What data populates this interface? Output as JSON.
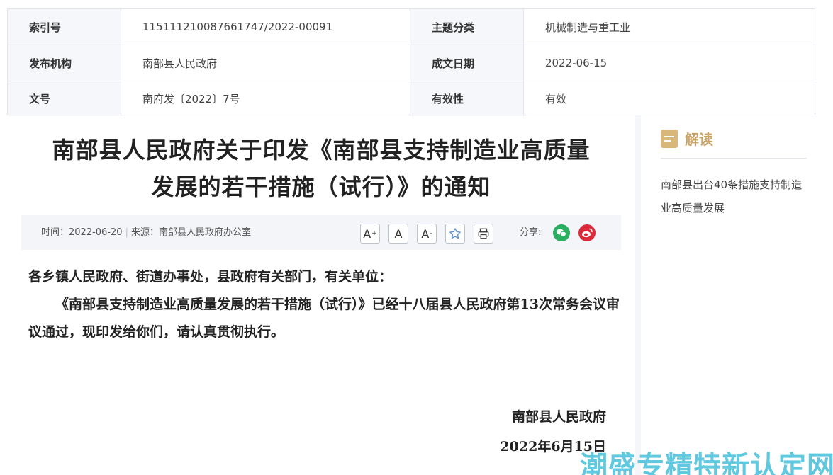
{
  "meta": {
    "rows": [
      {
        "label1": "索引号",
        "value1": "115111210087661747/2022-00091",
        "label2": "主题分类",
        "value2": "机械制造与重工业"
      },
      {
        "label1": "发布机构",
        "value1": "南部县人民政府",
        "label2": "成文日期",
        "value2": "2022-06-15"
      },
      {
        "label1": "文号",
        "value1": "南府发〔2022〕7号",
        "label2": "有效性",
        "value2": "有效"
      }
    ]
  },
  "article": {
    "title_line1": "南部县人民政府关于印发《南部县支持制造业高质量",
    "title_line2": "发展的若干措施（试行）》的通知",
    "time_label": "时间：2022-06-20",
    "source_label": "来源：南部县人民政府办公室",
    "tools": {
      "enlarge": "A",
      "normal": "A",
      "shrink": "A",
      "enlarge_sup": "+",
      "shrink_sup": "-"
    },
    "share_label": "分享:",
    "salutation": "各乡镇人民政府、街道办事处，县政府有关部门，有关单位：",
    "paragraph": "《南部县支持制造业高质量发展的若干措施（试行）》已经十八届县人民政府第13次常务会议审议通过，现印发给你们，请认真贯彻执行。",
    "sign_org": "南部县人民政府",
    "sign_date": "2022年6月15日"
  },
  "side": {
    "title": "解读",
    "link": "南部县出台40条措施支持制造业高质量发展"
  },
  "watermark": "潮盛专精特新认定网",
  "colors": {
    "accent_gold": "#c9a468",
    "wechat": "#2aae5f",
    "weibo": "#d92b3a",
    "watermark": "#4fc3dc"
  }
}
